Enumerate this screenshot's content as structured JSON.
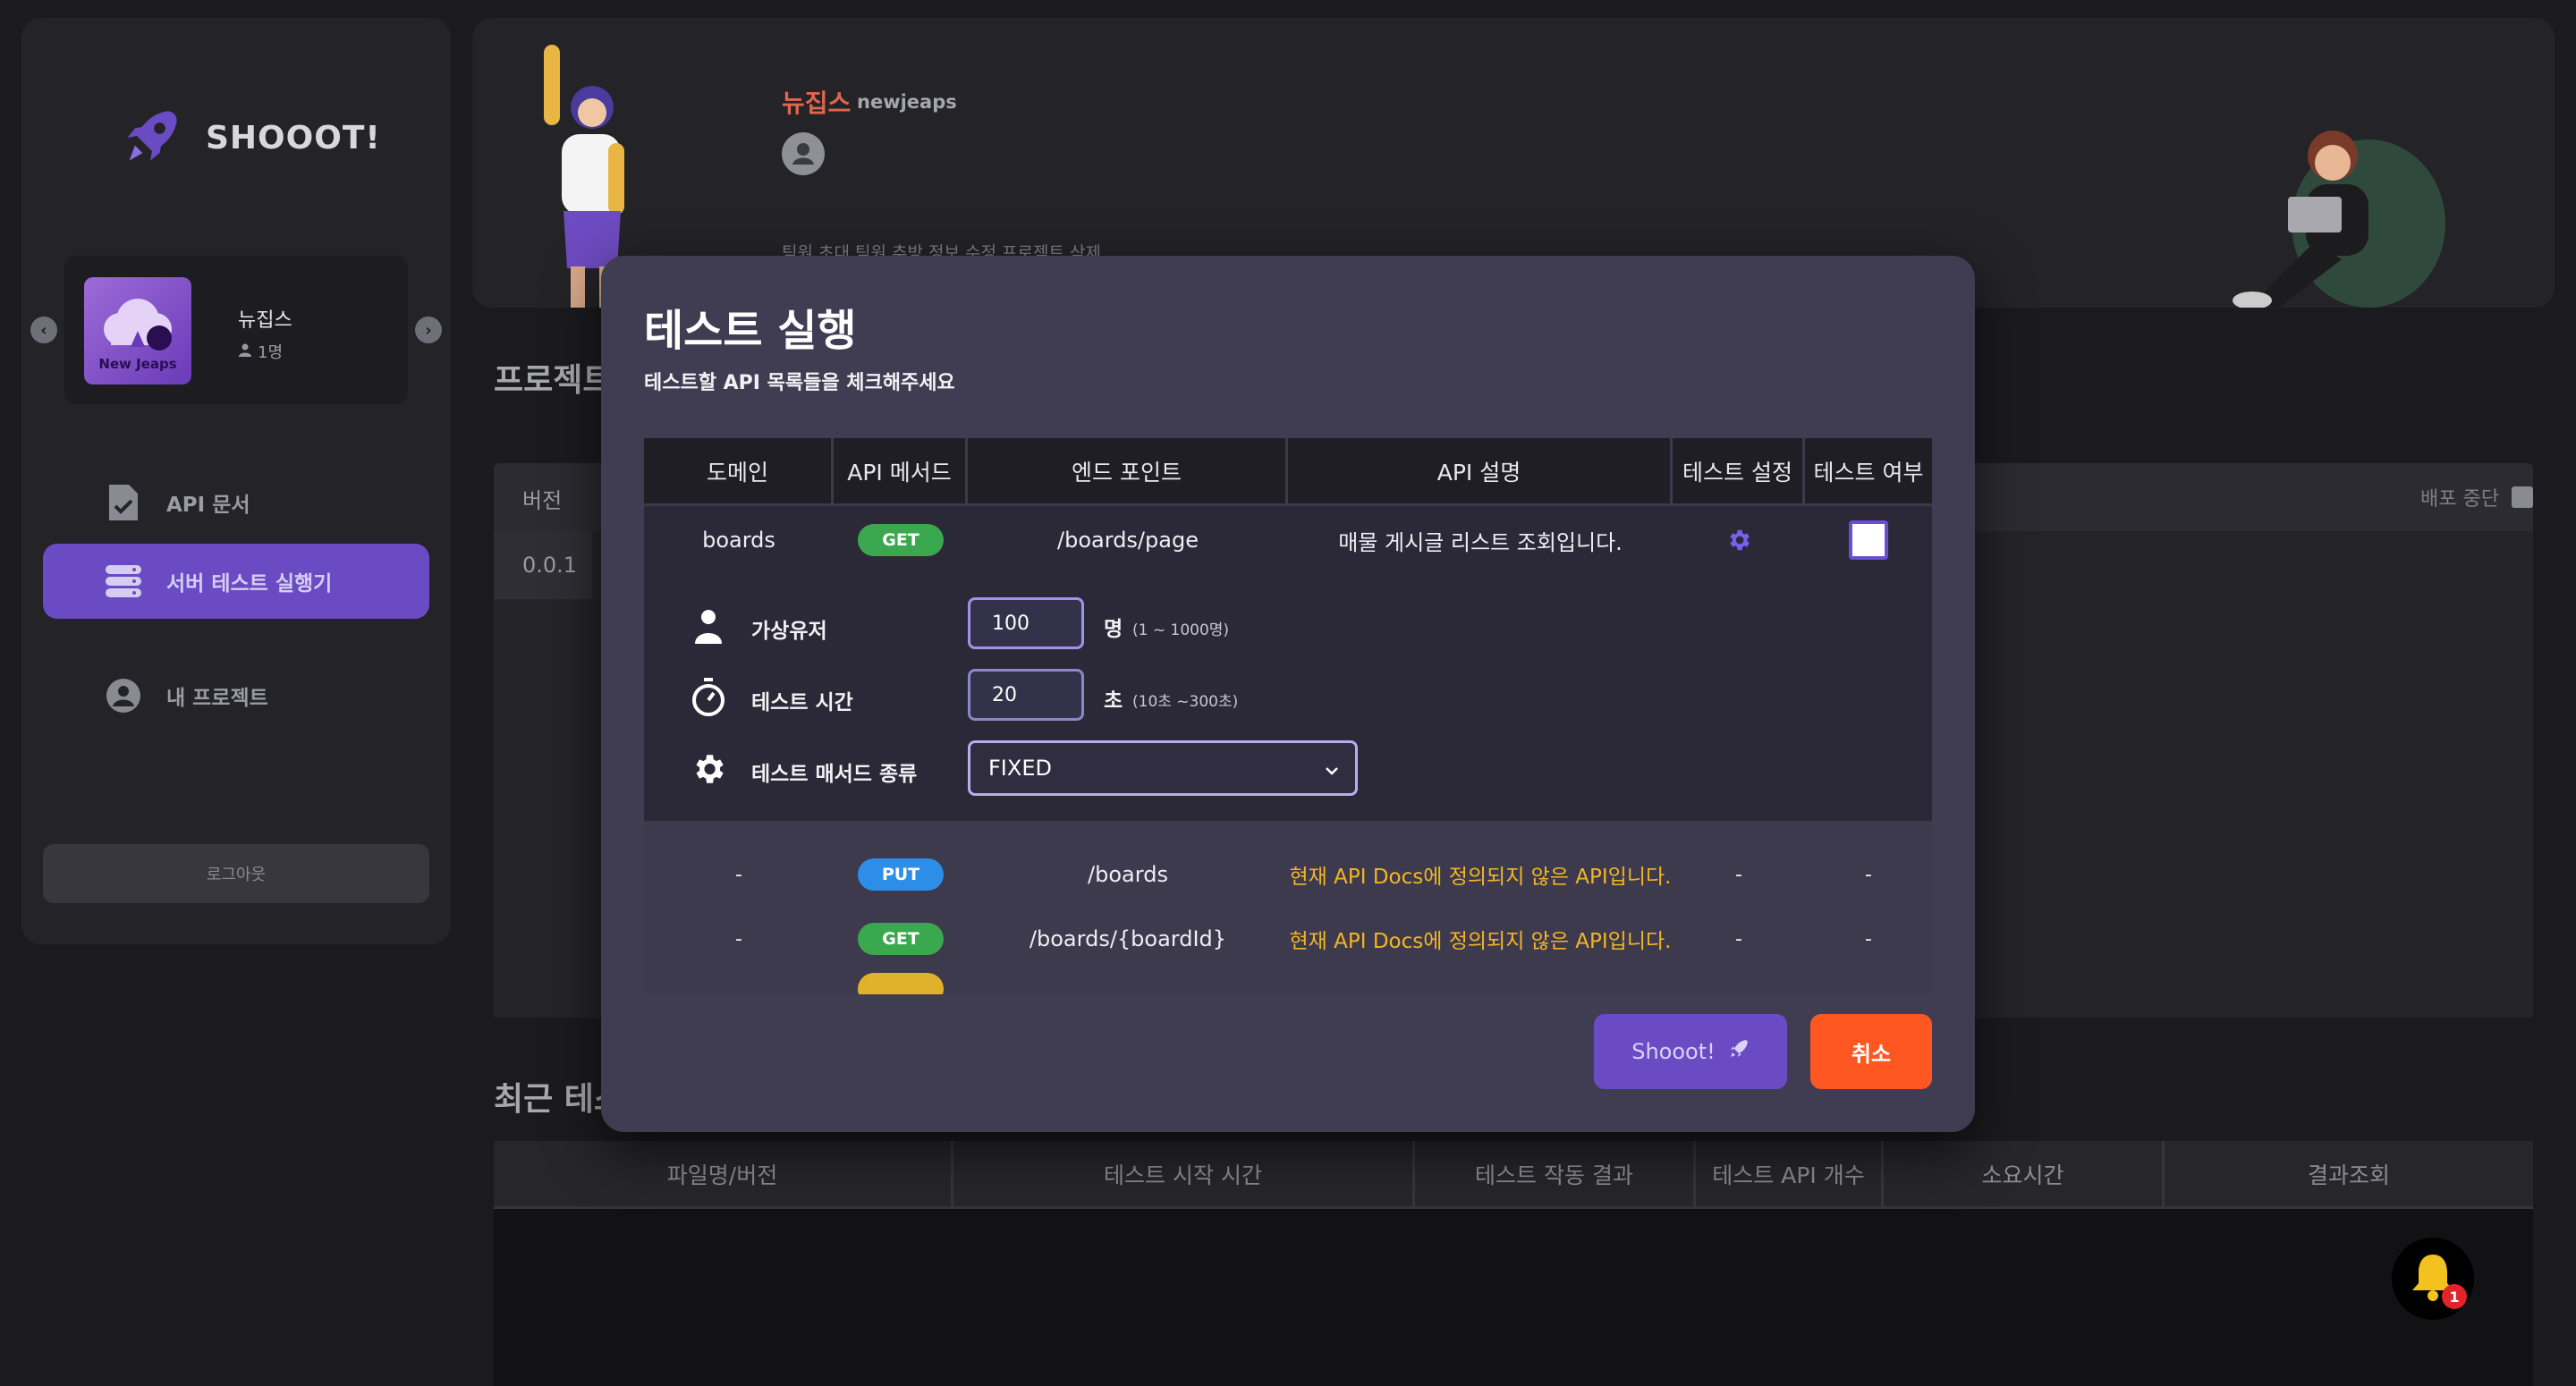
{
  "app": {
    "logo_text": "SHOOOT!"
  },
  "sidebar": {
    "team": {
      "name": "뉴집스",
      "thumb_text": "New Jeaps",
      "member_count": "1명"
    },
    "items": [
      {
        "label": "API 문서",
        "icon": "document-check-icon",
        "active": false
      },
      {
        "label": "서버 테스트 실행기",
        "icon": "server-icon",
        "active": true
      },
      {
        "label": "내 프로젝트",
        "icon": "user-circle-icon",
        "active": false
      }
    ],
    "logout_label": "로그아웃"
  },
  "project": {
    "name": "뉴집스",
    "slug": "newjeaps",
    "links": "팀원 초대  팀원 추방  정보 수정  프로젝트 삭제"
  },
  "project_section_title": "프로젝트",
  "version_table": {
    "header_version": "버전",
    "deploy_stop": "배포 중단",
    "rows": [
      {
        "version": "0.0.1"
      }
    ]
  },
  "recent_section_title": "최근 테스",
  "recent_table": {
    "columns": [
      "파일명/버전",
      "테스트 시작 시간",
      "테스트 작동 결과",
      "테스트 API 개수",
      "소요시간",
      "결과조회"
    ]
  },
  "notifications": {
    "count": "1"
  },
  "modal": {
    "title": "테스트 실행",
    "subtitle": "테스트할 API 목록들을 체크해주세요",
    "columns": [
      "도메인",
      "API 메서드",
      "엔드 포인트",
      "API 설명",
      "테스트 설정",
      "테스트 여부"
    ],
    "main_row": {
      "domain": "boards",
      "method": "GET",
      "endpoint": "/boards/page",
      "description": "매물 게시글 리스트 조회입니다."
    },
    "settings": {
      "virtual_users": {
        "label": "가상유저",
        "value": "100",
        "unit": "명",
        "range": "(1 ~ 1000명)"
      },
      "test_time": {
        "label": "테스트 시간",
        "value": "20",
        "unit": "초",
        "range": "(10초 ~300초)"
      },
      "method_type": {
        "label": "테스트 매서드 종류",
        "value": "FIXED"
      }
    },
    "other_rows": [
      {
        "domain": "-",
        "method": "PUT",
        "endpoint": "/boards",
        "description": "현재 API Docs에 정의되지 않은 API입니다.",
        "setting": "-",
        "check": "-"
      },
      {
        "domain": "-",
        "method": "GET",
        "endpoint": "/boards/{boardId}",
        "description": "현재 API Docs에 정의되지 않은 API입니다.",
        "setting": "-",
        "check": "-"
      }
    ],
    "shoot_label": "Shooot!",
    "cancel_label": "취소"
  },
  "colors": {
    "accent": "#6b4bc4",
    "cancel": "#ff5722",
    "get": "#3aa84e",
    "put": "#2d8ee8",
    "warning": "#f2b623",
    "project_name": "#e0664e"
  }
}
